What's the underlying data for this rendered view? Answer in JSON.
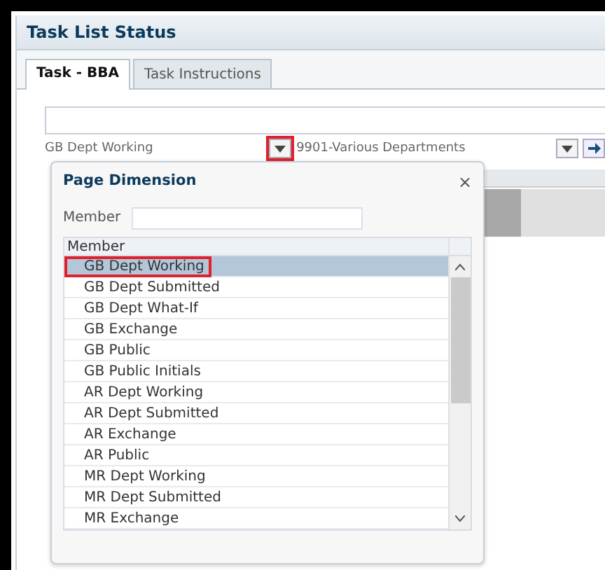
{
  "window": {
    "title": "Task List Status"
  },
  "tabs": [
    {
      "label": "Task - BBA",
      "selected": true
    },
    {
      "label": "Task Instructions",
      "selected": false
    }
  ],
  "pov": {
    "dimension_value": "GB Dept Working",
    "dimension_dropdown_highlighted": true,
    "department": "9901-Various Departments"
  },
  "popup": {
    "title": "Page Dimension",
    "close": "×",
    "search_label": "Member",
    "list_header": "Member",
    "items": [
      {
        "label": "GB Dept Working",
        "selected": true,
        "highlighted": true
      },
      {
        "label": "GB Dept Submitted",
        "selected": false,
        "highlighted": false
      },
      {
        "label": "GB Dept What-If",
        "selected": false,
        "highlighted": false
      },
      {
        "label": "GB Exchange",
        "selected": false,
        "highlighted": false
      },
      {
        "label": "GB Public",
        "selected": false,
        "highlighted": false
      },
      {
        "label": "GB Public Initials",
        "selected": false,
        "highlighted": false
      },
      {
        "label": "AR Dept Working",
        "selected": false,
        "highlighted": false
      },
      {
        "label": "AR Dept Submitted",
        "selected": false,
        "highlighted": false
      },
      {
        "label": "AR Exchange",
        "selected": false,
        "highlighted": false
      },
      {
        "label": "AR Public",
        "selected": false,
        "highlighted": false
      },
      {
        "label": "MR Dept Working",
        "selected": false,
        "highlighted": false
      },
      {
        "label": "MR Dept Submitted",
        "selected": false,
        "highlighted": false
      },
      {
        "label": "MR Exchange",
        "selected": false,
        "highlighted": false
      }
    ]
  }
}
